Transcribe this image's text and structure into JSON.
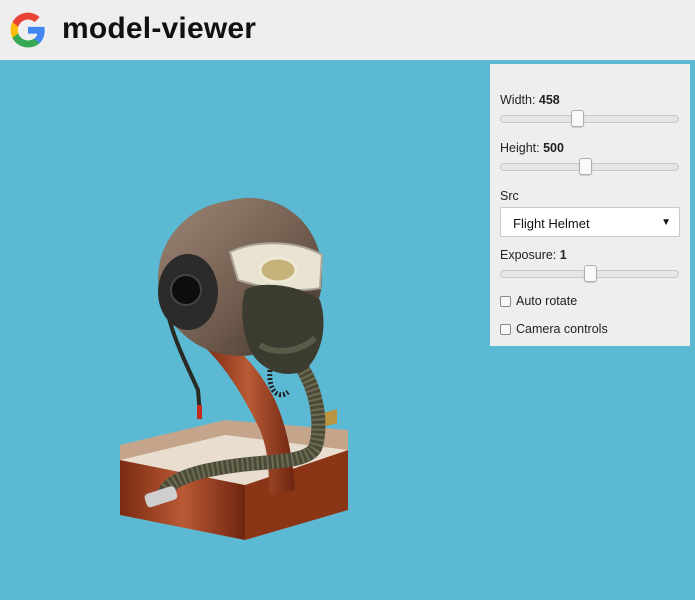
{
  "header": {
    "logo_icon": "google-g-logo",
    "title": "model-viewer"
  },
  "viewer": {
    "background": "#5cb9d3",
    "model_name": "Flight Helmet"
  },
  "controls": {
    "width": {
      "label": "Width: ",
      "value": "458",
      "slider_level": 0.42
    },
    "height": {
      "label": "Height: ",
      "value": "500",
      "slider_level": 0.47
    },
    "src": {
      "label": "Src",
      "selected": "Flight Helmet"
    },
    "exposure": {
      "label": "Exposure: ",
      "value": "1",
      "slider_level": 0.5
    },
    "auto_rotate": {
      "label": "Auto rotate",
      "checked": false
    },
    "camera_controls": {
      "label": "Camera controls",
      "checked": false
    }
  }
}
